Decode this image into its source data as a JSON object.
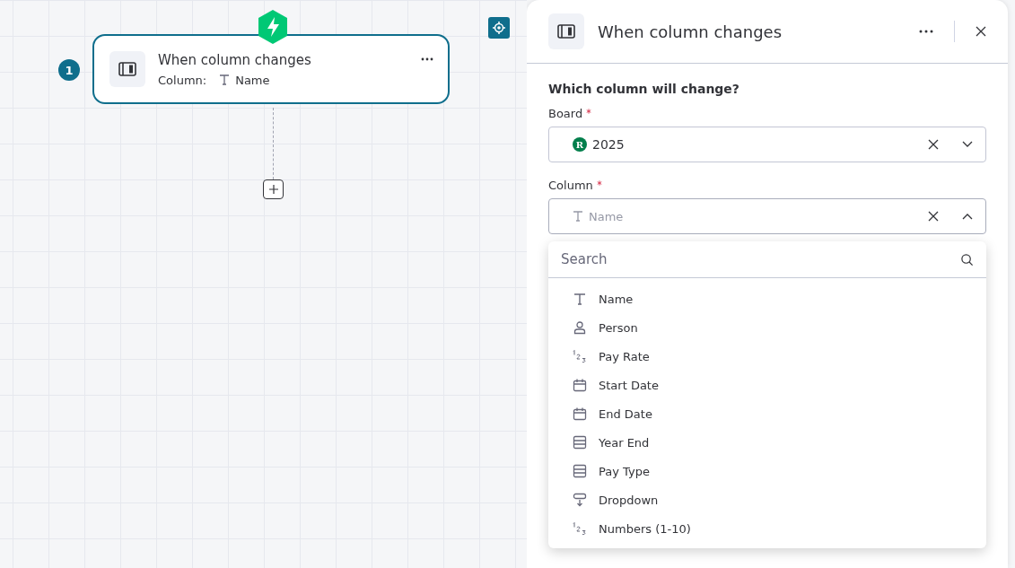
{
  "canvas": {
    "node": {
      "step": "1",
      "title": "When column changes",
      "field_label": "Column:",
      "field_value": "Name",
      "selected": true
    }
  },
  "panel": {
    "title": "When column changes",
    "section_title": "Which column will change?",
    "fields": [
      {
        "label": "Board",
        "required": true,
        "value": "2025",
        "badge": "R",
        "kind": "board",
        "expanded": false
      },
      {
        "label": "Column",
        "required": true,
        "value": "Name",
        "kind": "column",
        "expanded": true
      }
    ],
    "dropdown": {
      "search": {
        "placeholder": "Search"
      },
      "options": [
        {
          "label": "Name",
          "kind": "text"
        },
        {
          "label": "Person",
          "kind": "person"
        },
        {
          "label": "Pay Rate",
          "kind": "numbers"
        },
        {
          "label": "Start Date",
          "kind": "date"
        },
        {
          "label": "End Date",
          "kind": "date"
        },
        {
          "label": "Year End",
          "kind": "table"
        },
        {
          "label": "Pay Type",
          "kind": "table"
        },
        {
          "label": "Dropdown",
          "kind": "dropdown"
        },
        {
          "label": "Numbers (1-10)",
          "kind": "numbers"
        }
      ]
    }
  }
}
